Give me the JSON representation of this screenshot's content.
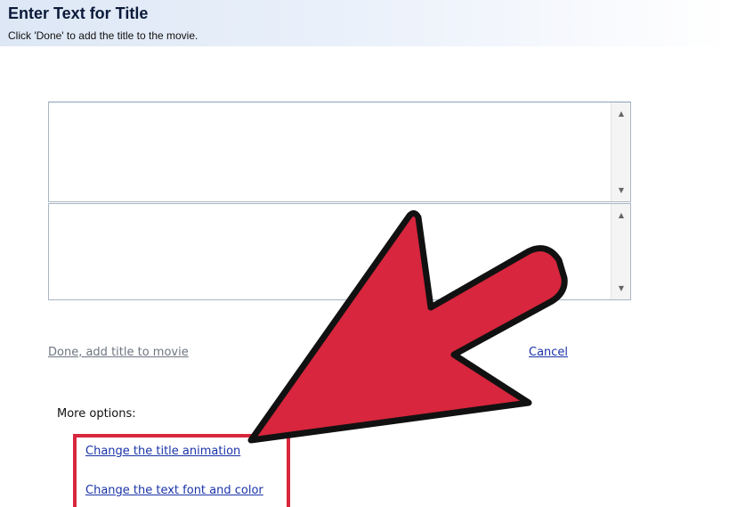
{
  "header": {
    "title": "Enter Text for Title",
    "subtitle": "Click 'Done' to add the title to the movie."
  },
  "text_fields": [
    {
      "value": ""
    },
    {
      "value": ""
    }
  ],
  "actions": {
    "done_label": "Done, add title to movie",
    "cancel_label": "Cancel"
  },
  "more_options": {
    "label": "More options:",
    "items": [
      {
        "label": "Change the title animation"
      },
      {
        "label": "Change the text font and color"
      }
    ]
  },
  "annotation": {
    "arrow_color": "#d7263d",
    "outline_color": "#111111",
    "highlight_color": "#d7263d"
  },
  "icons": {
    "scroll_up": "▲",
    "scroll_down": "▼"
  }
}
